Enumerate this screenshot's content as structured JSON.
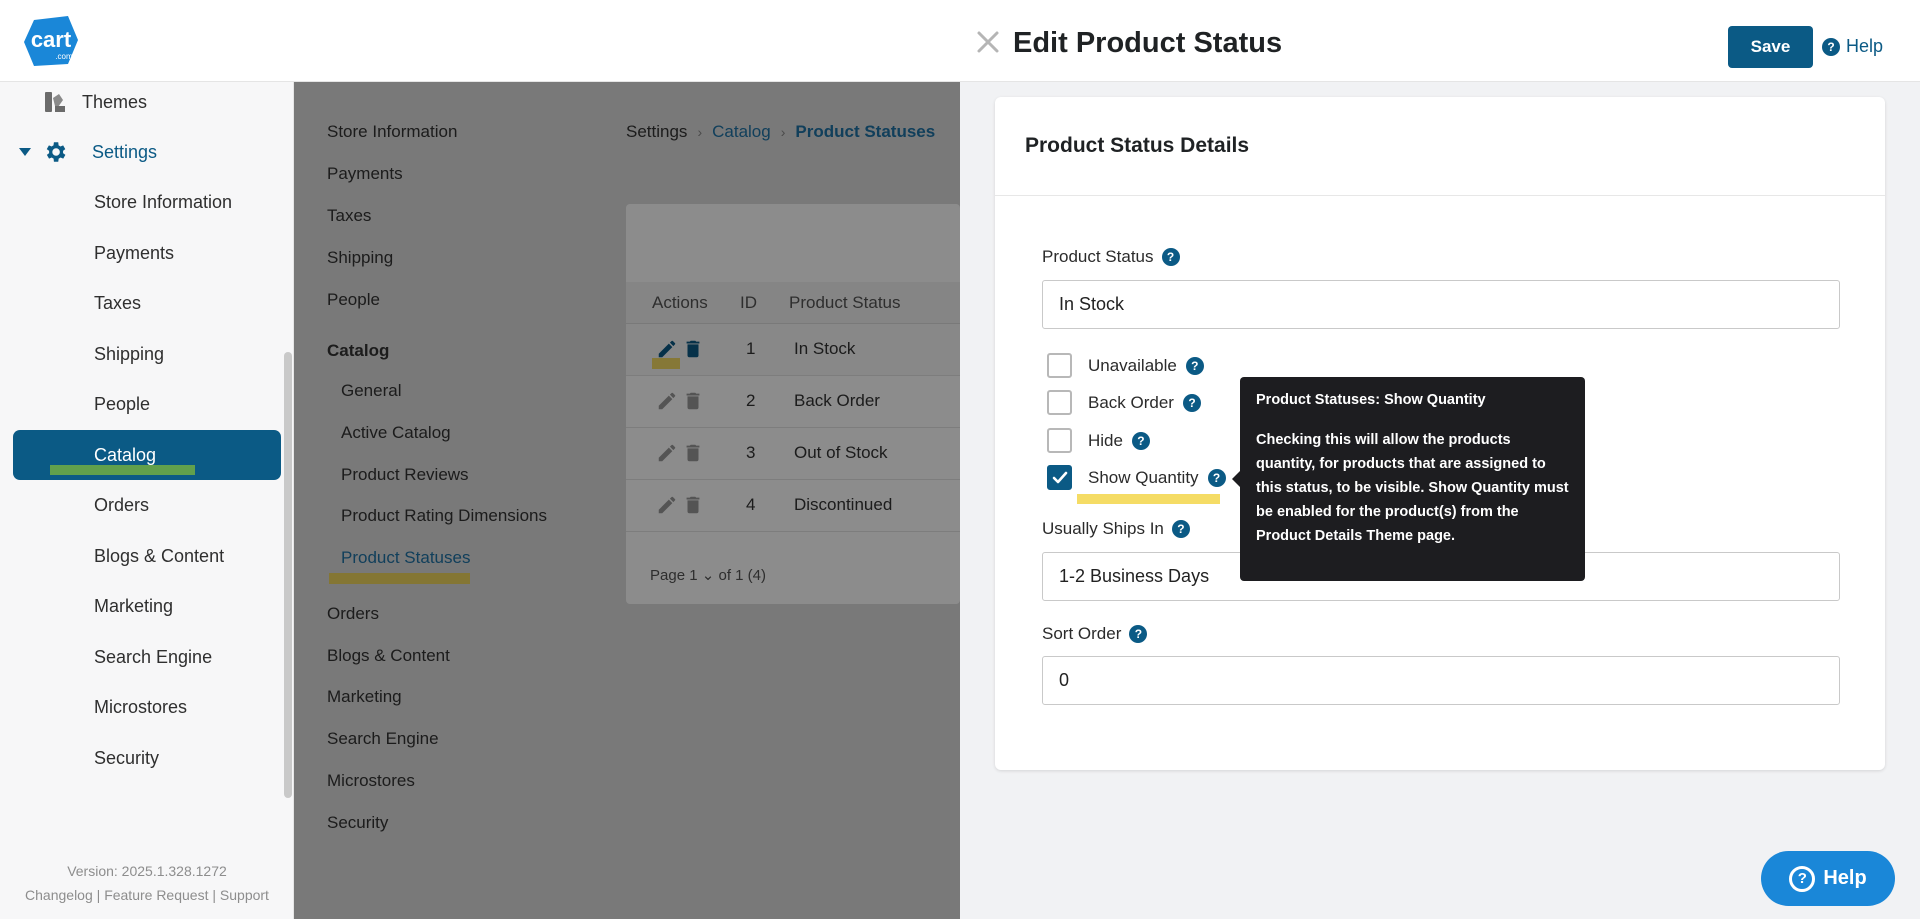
{
  "app": {
    "logo_text": "cart",
    "logo_sub": ".com"
  },
  "sidebar": {
    "top_items": [
      {
        "label": "Themes",
        "icon": "themes-icon"
      },
      {
        "label": "Settings",
        "icon": "gear-icon"
      }
    ],
    "sub_items": [
      {
        "label": "Store Information"
      },
      {
        "label": "Payments"
      },
      {
        "label": "Taxes"
      },
      {
        "label": "Shipping"
      },
      {
        "label": "People"
      },
      {
        "label": "Catalog"
      },
      {
        "label": "Orders"
      },
      {
        "label": "Blogs & Content"
      },
      {
        "label": "Marketing"
      },
      {
        "label": "Search Engine"
      },
      {
        "label": "Microstores"
      },
      {
        "label": "Security"
      }
    ],
    "version": "Version: 2025.1.328.1272",
    "footer_links": [
      "Changelog",
      "Feature Request",
      "Support"
    ],
    "footer_sep": "|"
  },
  "settings_nav": {
    "top": [
      "Store Information",
      "Payments",
      "Taxes",
      "Shipping",
      "People"
    ],
    "catalog_heading": "Catalog",
    "catalog_items": [
      "General",
      "Active Catalog",
      "Product Reviews",
      "Product Rating Dimensions",
      "Product Statuses"
    ],
    "bottom": [
      "Orders",
      "Blogs & Content",
      "Marketing",
      "Search Engine",
      "Microstores",
      "Security"
    ]
  },
  "breadcrumb": {
    "root": "Settings",
    "parent": "Catalog",
    "current": "Product Statuses"
  },
  "grid": {
    "columns": [
      "Actions",
      "ID",
      "Product Status"
    ],
    "rows": [
      {
        "id": "1",
        "status": "In Stock"
      },
      {
        "id": "2",
        "status": "Back Order"
      },
      {
        "id": "3",
        "status": "Out of Stock"
      },
      {
        "id": "4",
        "status": "Discontinued"
      }
    ],
    "pager_page_label": "Page",
    "pager_page_value": "1",
    "pager_total": "of 1 (4)"
  },
  "panel": {
    "title": "Edit Product Status",
    "save_label": "Save",
    "help_label": "Help",
    "card_title": "Product Status Details",
    "product_status_label": "Product Status",
    "product_status_value": "In Stock",
    "checkboxes": [
      {
        "label": "Unavailable",
        "checked": false
      },
      {
        "label": "Back Order",
        "checked": false
      },
      {
        "label": "Hide",
        "checked": false
      },
      {
        "label": "Show Quantity",
        "checked": true
      }
    ],
    "ships_label": "Usually Ships In",
    "ships_value": "1-2 Business Days",
    "sort_label": "Sort Order",
    "sort_value": "0"
  },
  "tooltip": {
    "title": "Product Statuses: Show Quantity",
    "body": "Checking this will allow the products quantity, for products that are assigned to this status, to be visible. Show Quantity must be enabled for the product(s) from the Product Details Theme page."
  },
  "help_fab": {
    "label": "Help"
  },
  "colors": {
    "brand": "#0b5a85",
    "help_fab": "#1a87d8",
    "highlight_yellow": "#f3d64a",
    "highlight_green": "#7fb83a"
  }
}
